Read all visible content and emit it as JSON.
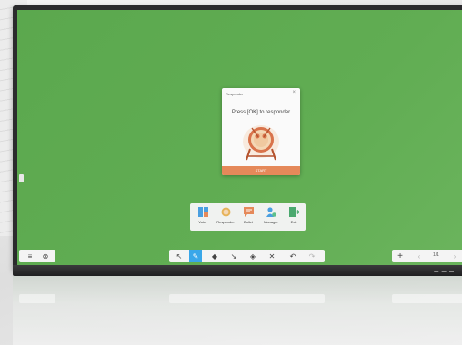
{
  "dialog": {
    "title": "Responder",
    "close_glyph": "×",
    "message": "Press [OK] to responder",
    "start_label": "START",
    "accent": "#e5895a"
  },
  "apps": [
    {
      "label": "Voter",
      "icon": "voter-icon"
    },
    {
      "label": "Responder",
      "icon": "responder-icon"
    },
    {
      "label": "Bullet",
      "icon": "bullet-icon"
    },
    {
      "label": "Manager",
      "icon": "manager-icon"
    },
    {
      "label": "Exit",
      "icon": "exit-icon"
    }
  ],
  "toolbar": {
    "left": {
      "menu_glyph": "≡",
      "close_glyph": "⊗"
    },
    "center": {
      "select_glyph": "↖",
      "pen_glyph": "✎",
      "eraser_glyph": "◆",
      "pointer_glyph": "↘",
      "shapes_glyph": "◈",
      "tools_glyph": "✕",
      "undo_glyph": "↶",
      "redo_glyph": "↷"
    },
    "right": {
      "add_glyph": "+",
      "prev_glyph": "‹",
      "page": "1/1",
      "next_glyph": "›"
    }
  },
  "colors": {
    "screen": "#5ba84e",
    "active_tool": "#3aa7e9",
    "bezel": "#2b2b2d"
  }
}
